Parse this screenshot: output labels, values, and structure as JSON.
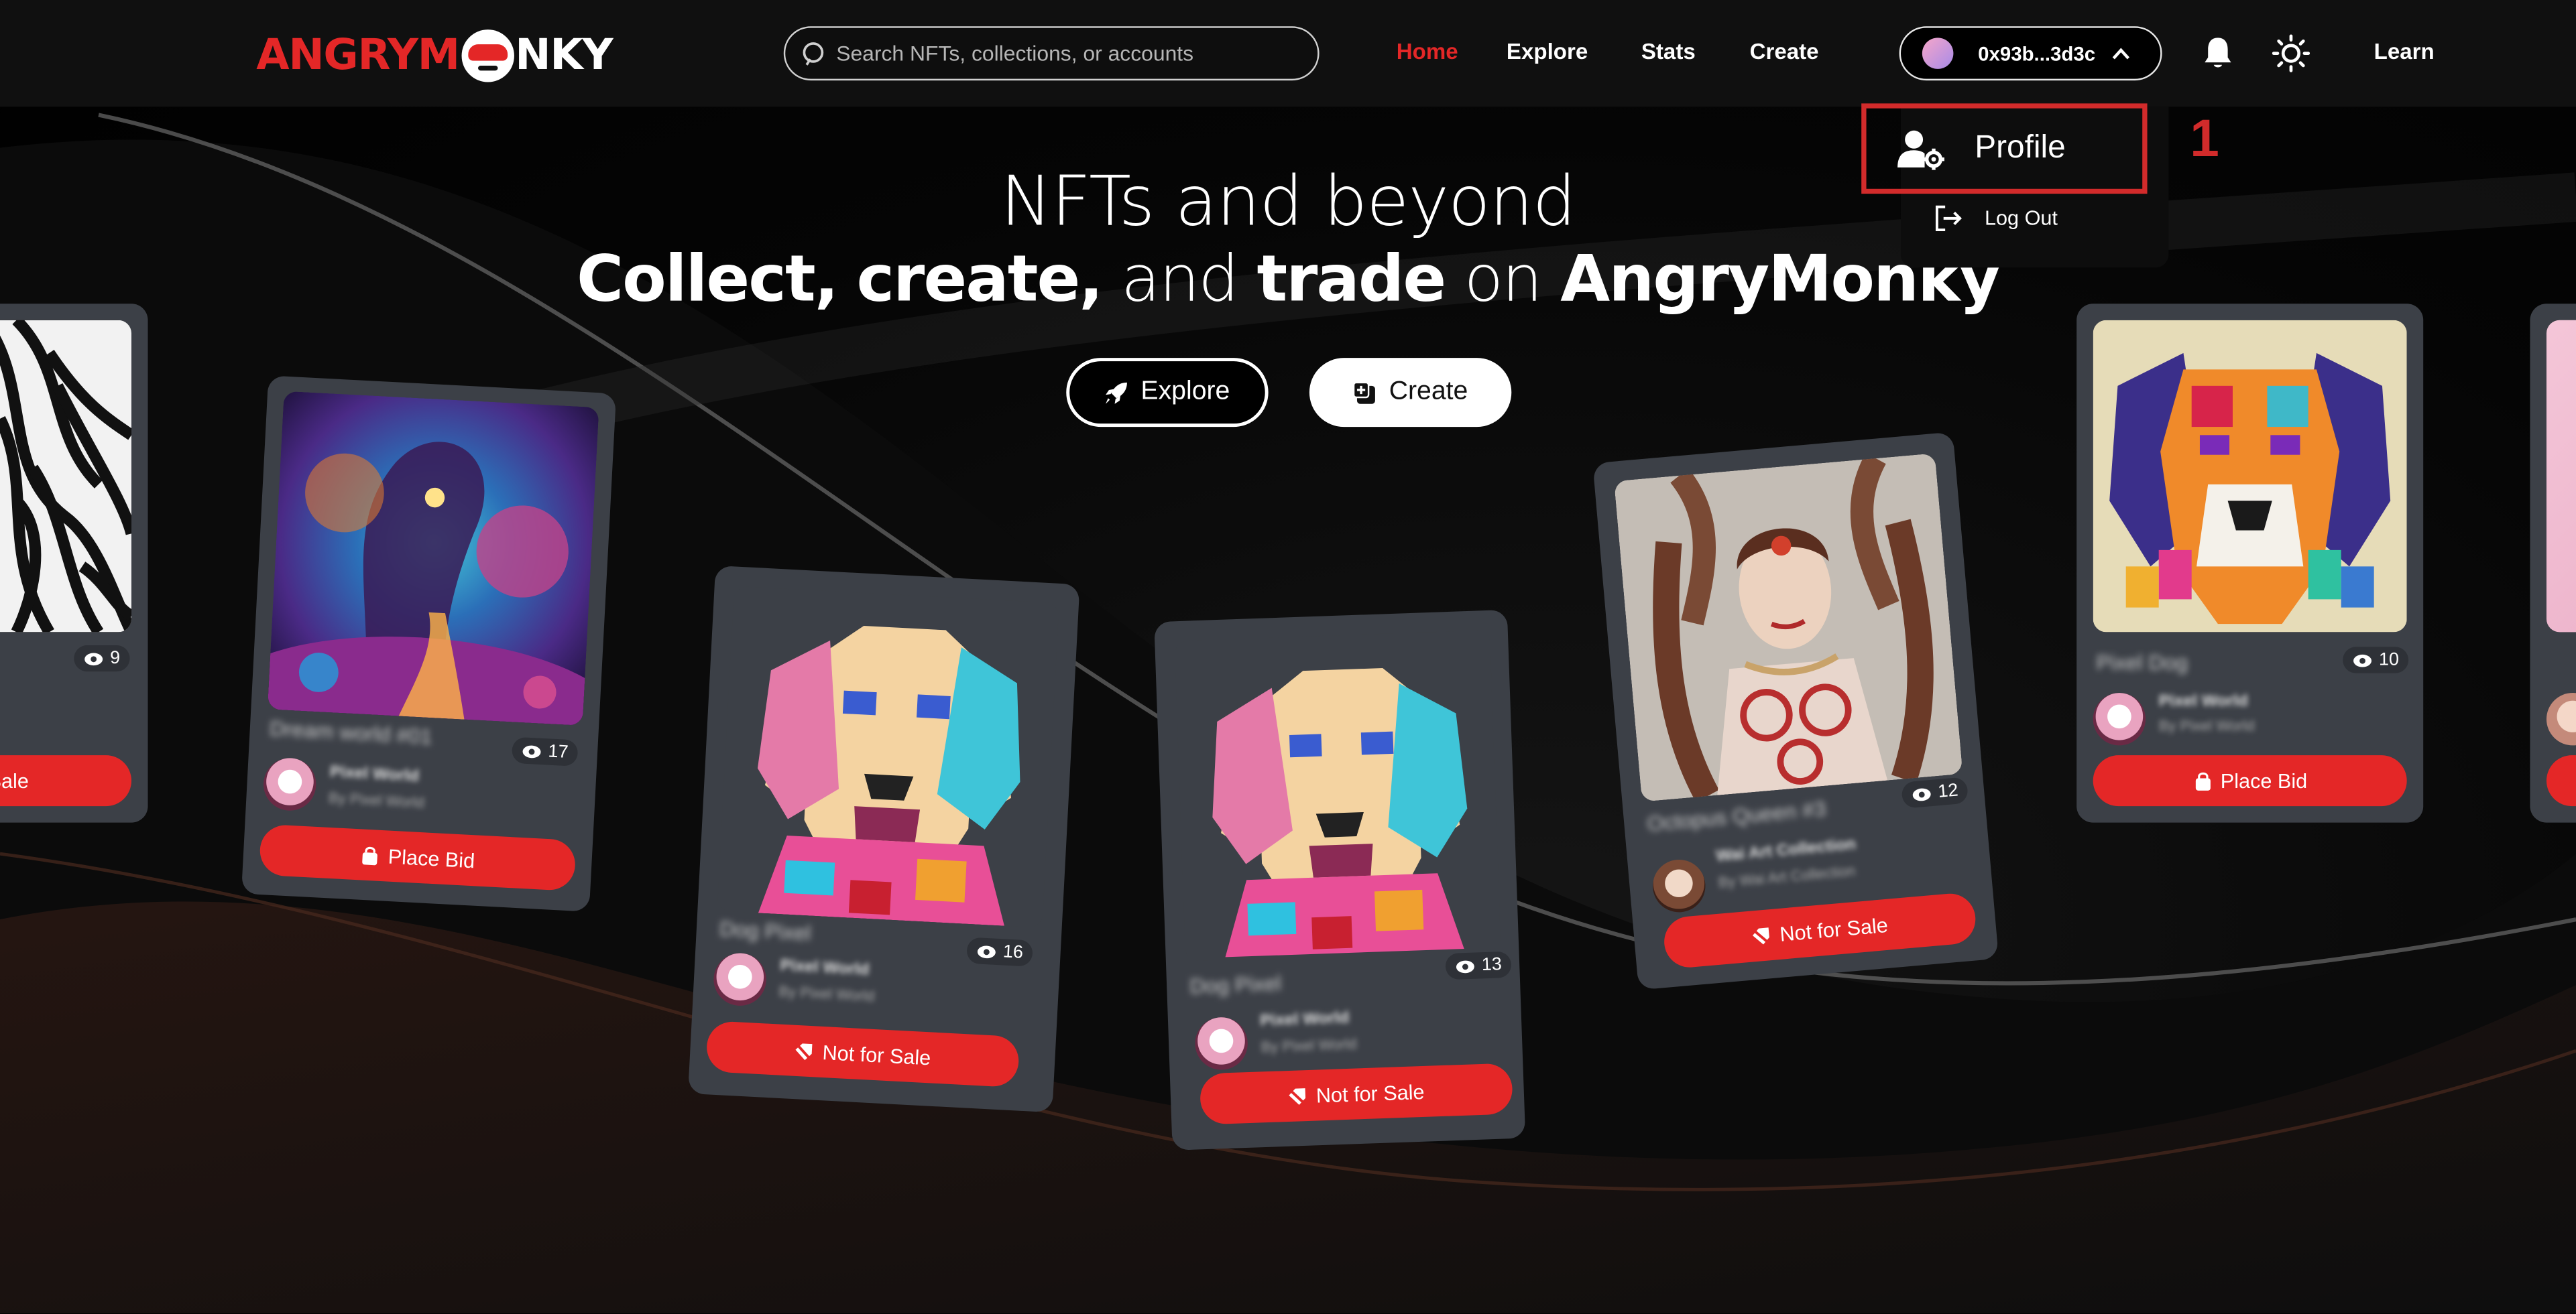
{
  "navbar": {
    "logo": {
      "part1": "ANGRY",
      "part2": "M",
      "part3": "NKY"
    },
    "search": {
      "placeholder": "Search NFTs, collections, or accounts"
    },
    "links": {
      "home": "Home",
      "explore": "Explore",
      "stats": "Stats",
      "create": "Create",
      "learn": "Learn"
    },
    "wallet": {
      "address": "0x93b...3d3c"
    },
    "icons": {
      "search": "search-icon",
      "bell": "bell-icon",
      "theme": "sun-icon",
      "chevron": "chevron-up-icon"
    }
  },
  "dropdown": {
    "profile_label": "Profile",
    "logout_label": "Log Out",
    "annotation": "1"
  },
  "hero": {
    "line1": "NFTs and beyond",
    "line2": {
      "w1": "Collect,",
      "w2": "create,",
      "w3": "and",
      "w4": "trade",
      "w5": "on",
      "w6": "AngryMonky"
    },
    "explore_button": "Explore",
    "create_button": "Create"
  },
  "colors": {
    "accent": "#e42727",
    "card": "#3c4047",
    "background": "#000000"
  },
  "cards": [
    {
      "title": "",
      "views": "9",
      "owner": "",
      "owner_sub": "",
      "action": "Sale"
    },
    {
      "title": "Dream world #01",
      "views": "17",
      "owner": "Pixel World",
      "owner_sub": "By Pixel World",
      "action": "Place Bid"
    },
    {
      "title": "Dog Pixel",
      "views": "16",
      "owner": "Pixel World",
      "owner_sub": "By Pixel World",
      "action": "Not for Sale"
    },
    {
      "title": "Dog Pixel",
      "views": "13",
      "owner": "Pixel World",
      "owner_sub": "By Pixel World",
      "action": "Not for Sale"
    },
    {
      "title": "Octopus Queen #3",
      "views": "12",
      "owner": "Wai Art Collection",
      "owner_sub": "By Wai Art Collection",
      "action": "Not for Sale"
    },
    {
      "title": "Pixel Dog",
      "views": "10",
      "owner": "Pixel World",
      "owner_sub": "By Pixel World",
      "action": "Place Bid"
    }
  ]
}
